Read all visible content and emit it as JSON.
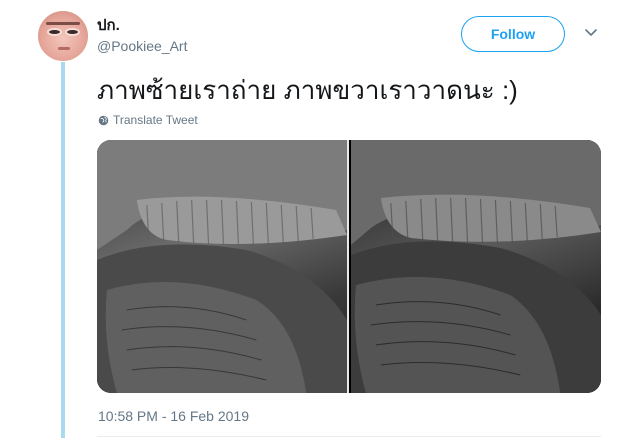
{
  "author": {
    "display_name": "ปก.",
    "handle": "@Pookiee_Art"
  },
  "follow_label": "Follow",
  "tweet": {
    "text": "ภาพซ้ายเราถ่าย ภาพขวาเราวาดนะ :)",
    "translate_label": "Translate Tweet",
    "timestamp": "10:58 PM - 16 Feb 2019"
  },
  "icons": {
    "menu": "chevron-down-icon",
    "translate": "globe-icon"
  },
  "colors": {
    "accent": "#1da1f2",
    "thread_line": "#a9d8ef",
    "secondary_text": "#657786"
  }
}
